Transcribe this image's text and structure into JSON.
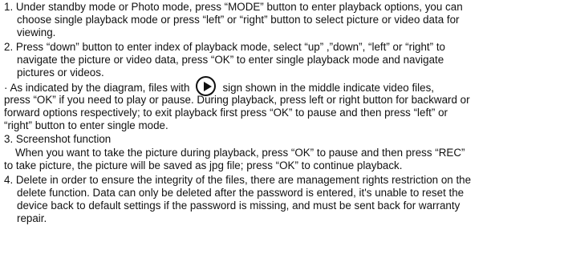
{
  "lines": {
    "l0": "1. Under standby mode or Photo mode, press “MODE” button to enter playback options, you can",
    "l1": "choose single playback mode or press “left” or “right” button to select picture or video data for",
    "l2": "viewing.",
    "l3": "2. Press “down” button to enter index of playback mode, select “up” ,”down”, “left” or “right” to",
    "l4": "navigate the picture or video data, press “OK” to enter single playback mode and navigate",
    "l5": "pictures or videos.",
    "l6a": "· As indicated by the diagram, files with",
    "l6b": "sign shown in the middle indicate video files,",
    "l7": "press “OK” if you need to play or pause. During playback, press left or right button for  backward or",
    "l8": "forward options respectively; to exit playback first press “OK” to pause and then press “left” or",
    "l9": "“right” button to enter single mode.",
    "l10": "3. Screenshot function",
    "l11": "When you want to take the picture during playback, press “OK” to pause and then press “REC”",
    "l12": "to take picture, the picture will be saved as jpg file; press “OK” to continue playback.",
    "l13": "4. Delete in order to ensure the integrity of the files, there are management rights restriction on the",
    "l14": "delete function. Data can only be deleted after the password is entered, it's unable to reset the",
    "l15": "device back to default settings if the password is missing, and must be sent back for warranty",
    "l16": "repair."
  },
  "icons": {
    "video": "play-circle-icon"
  }
}
